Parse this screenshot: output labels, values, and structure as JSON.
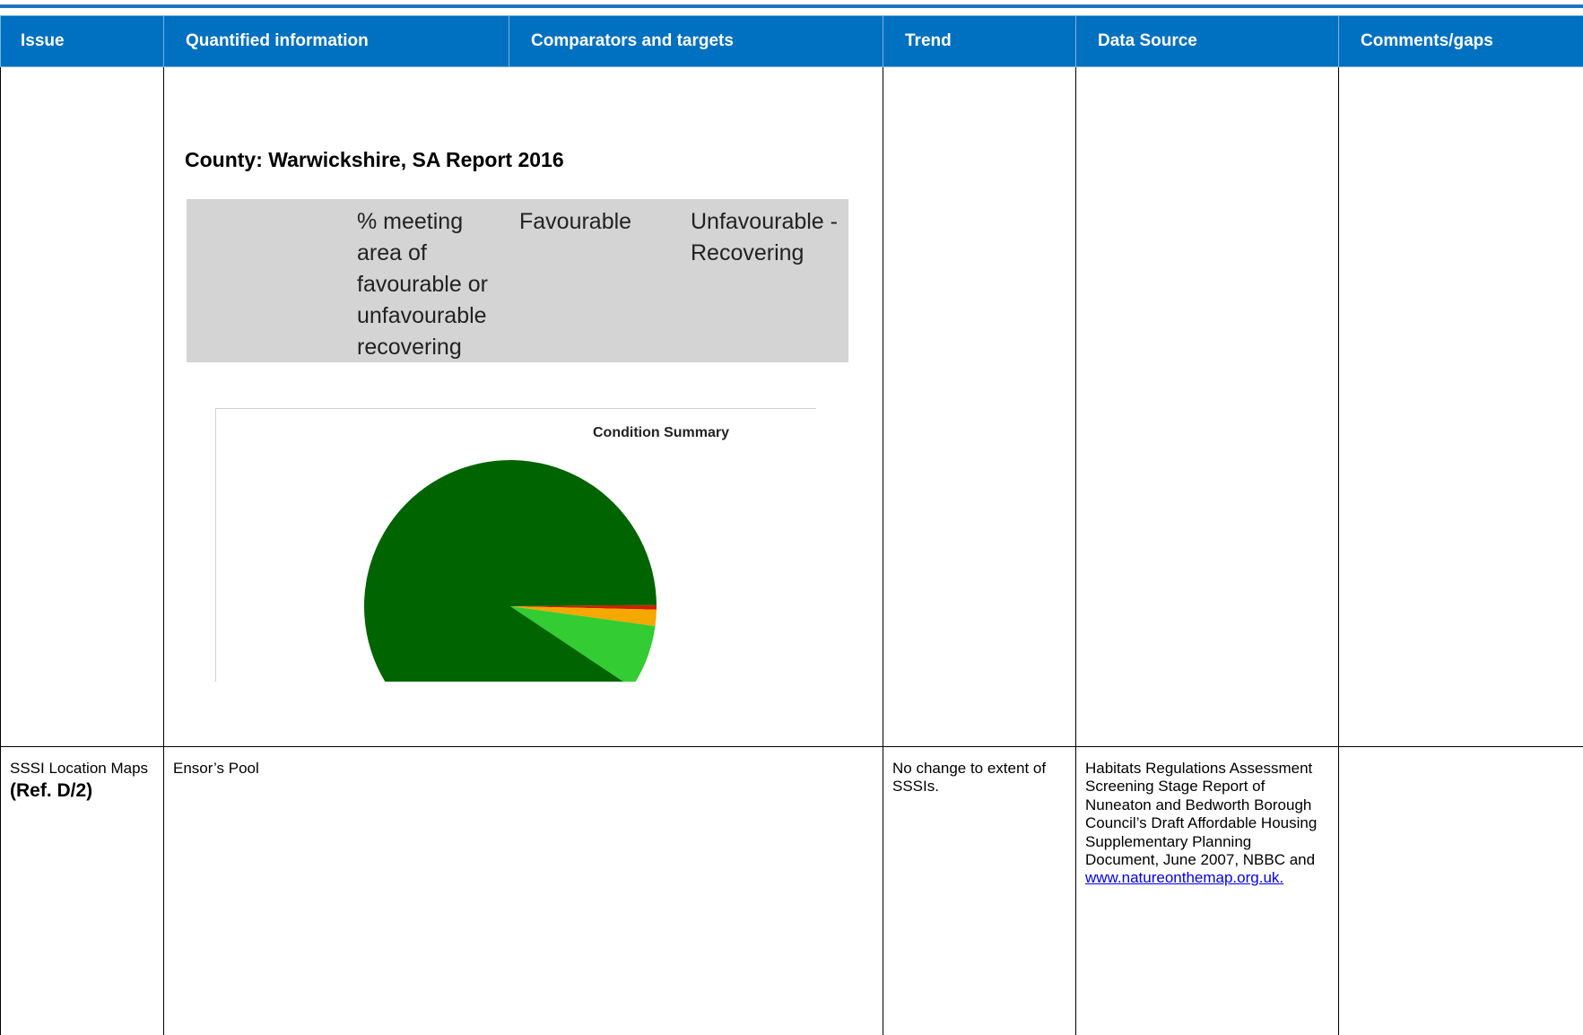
{
  "table": {
    "headers": {
      "issue": "Issue",
      "quantified": "Quantified information",
      "comparators": "Comparators and targets",
      "trend": "Trend",
      "source": "Data Source",
      "comments": "Comments/gaps"
    },
    "embedded_report": {
      "heading": "County: Warwickshire, SA Report 2016",
      "grey_header": {
        "col1": "% meeting area of favourable or unfavourable recovering",
        "col2": "Favourable",
        "col3": "Unfavourable - Recovering"
      }
    },
    "row2": {
      "issue_label": "SSSI Location Maps",
      "issue_ref": "(Ref. D/2)",
      "quantified": "Ensor’s Pool",
      "trend": "No change to extent of SSSIs.",
      "source_text": "Habitats Regulations Assessment Screening Stage Report of Nuneaton and Bedworth Borough Council’s Draft Affordable Housing Supplementary Planning Document, June 2007, NBBC and",
      "source_link": "www.natureonthemap.org.uk."
    }
  },
  "chart_data": {
    "type": "pie",
    "title": "Condition Summary",
    "slices": [
      {
        "value": 0.5,
        "color": "#cc2200"
      },
      {
        "value": 1.8,
        "color": "#f5a800"
      },
      {
        "value": 7.2,
        "color": "#33cc33"
      },
      {
        "value": 90.5,
        "color": "#006400"
      }
    ],
    "note": "pie is cropped at the bottom of the embedded picture"
  }
}
